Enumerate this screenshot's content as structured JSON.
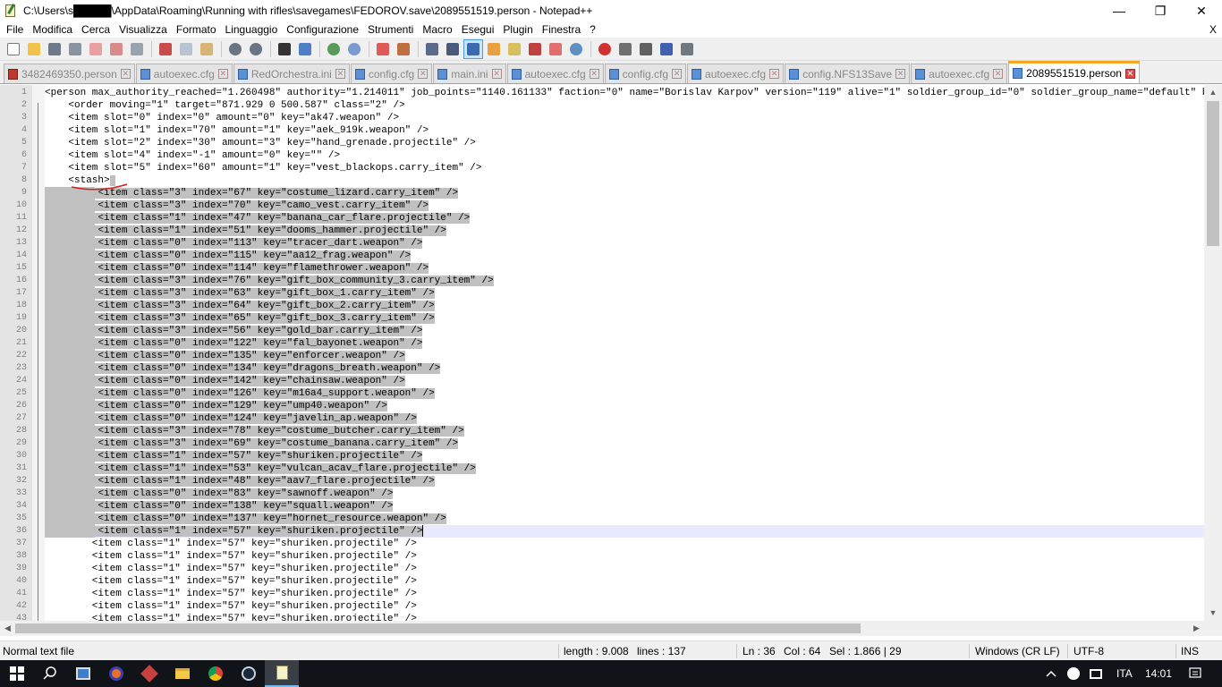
{
  "window": {
    "title": "C:\\Users\\s█████\\AppData\\Roaming\\Running with rifles\\savegames\\FEDOROV.save\\2089551519.person - Notepad++",
    "minimize": "—",
    "maximize": "❐",
    "close": "✕"
  },
  "menu": {
    "items": [
      "File",
      "Modifica",
      "Cerca",
      "Visualizza",
      "Formato",
      "Linguaggio",
      "Configurazione",
      "Strumenti",
      "Macro",
      "Esegui",
      "Plugin",
      "Finestra",
      "?"
    ],
    "close": "X"
  },
  "tabs": [
    {
      "label": "3482469350.person",
      "icon": "file-red"
    },
    {
      "label": "autoexec.cfg",
      "icon": "file-blue"
    },
    {
      "label": "RedOrchestra.ini",
      "icon": "file-blue"
    },
    {
      "label": "config.cfg",
      "icon": "file-blue"
    },
    {
      "label": "main.ini",
      "icon": "file-blue"
    },
    {
      "label": "autoexec.cfg",
      "icon": "file-blue"
    },
    {
      "label": "config.cfg",
      "icon": "file-blue"
    },
    {
      "label": "autoexec.cfg",
      "icon": "file-blue"
    },
    {
      "label": "config.NFS13Save",
      "icon": "file-blue"
    },
    {
      "label": "autoexec.cfg",
      "icon": "file-blue"
    },
    {
      "label": "2089551519.person",
      "icon": "file-blue",
      "active": true
    }
  ],
  "editor": {
    "lines": [
      {
        "n": "1",
        "text": "<person max_authority_reached=\"1.260498\" authority=\"1.214011\" job_points=\"1140.161133\" faction=\"0\" name=\"Borislav Karpov\" version=\"119\" alive=\"1\" soldier_group_id=\"0\" soldier_group_name=\"default\" block=\"",
        "sel": "none"
      },
      {
        "n": "2",
        "text": "    <order moving=\"1\" target=\"871.929 0 500.587\" class=\"2\" />",
        "sel": "none"
      },
      {
        "n": "3",
        "text": "    <item slot=\"0\" index=\"0\" amount=\"0\" key=\"ak47.weapon\" />",
        "sel": "none"
      },
      {
        "n": "4",
        "text": "    <item slot=\"1\" index=\"70\" amount=\"1\" key=\"aek_919k.weapon\" />",
        "sel": "none"
      },
      {
        "n": "5",
        "text": "    <item slot=\"2\" index=\"30\" amount=\"3\" key=\"hand_grenade.projectile\" />",
        "sel": "none"
      },
      {
        "n": "6",
        "text": "    <item slot=\"4\" index=\"-1\" amount=\"0\" key=\"\" />",
        "sel": "none"
      },
      {
        "n": "7",
        "text": "    <item slot=\"5\" index=\"60\" amount=\"1\" key=\"vest_blackops.carry_item\" />",
        "sel": "none"
      },
      {
        "n": "8",
        "text": "    <stash>",
        "sel": "tail"
      },
      {
        "n": "9",
        "text": "        <item class=\"3\" index=\"67\" key=\"costume_lizard.carry_item\" />",
        "sel": "full"
      },
      {
        "n": "10",
        "text": "        <item class=\"3\" index=\"70\" key=\"camo_vest.carry_item\" />",
        "sel": "full"
      },
      {
        "n": "11",
        "text": "        <item class=\"1\" index=\"47\" key=\"banana_car_flare.projectile\" />",
        "sel": "full"
      },
      {
        "n": "12",
        "text": "        <item class=\"1\" index=\"51\" key=\"dooms_hammer.projectile\" />",
        "sel": "full"
      },
      {
        "n": "13",
        "text": "        <item class=\"0\" index=\"113\" key=\"tracer_dart.weapon\" />",
        "sel": "full"
      },
      {
        "n": "14",
        "text": "        <item class=\"0\" index=\"115\" key=\"aa12_frag.weapon\" />",
        "sel": "full"
      },
      {
        "n": "15",
        "text": "        <item class=\"0\" index=\"114\" key=\"flamethrower.weapon\" />",
        "sel": "full"
      },
      {
        "n": "16",
        "text": "        <item class=\"3\" index=\"76\" key=\"gift_box_community_3.carry_item\" />",
        "sel": "full"
      },
      {
        "n": "17",
        "text": "        <item class=\"3\" index=\"63\" key=\"gift_box_1.carry_item\" />",
        "sel": "full"
      },
      {
        "n": "18",
        "text": "        <item class=\"3\" index=\"64\" key=\"gift_box_2.carry_item\" />",
        "sel": "full"
      },
      {
        "n": "19",
        "text": "        <item class=\"3\" index=\"65\" key=\"gift_box_3.carry_item\" />",
        "sel": "full"
      },
      {
        "n": "20",
        "text": "        <item class=\"3\" index=\"56\" key=\"gold_bar.carry_item\" />",
        "sel": "full"
      },
      {
        "n": "21",
        "text": "        <item class=\"0\" index=\"122\" key=\"fal_bayonet.weapon\" />",
        "sel": "full"
      },
      {
        "n": "22",
        "text": "        <item class=\"0\" index=\"135\" key=\"enforcer.weapon\" />",
        "sel": "full"
      },
      {
        "n": "23",
        "text": "        <item class=\"0\" index=\"134\" key=\"dragons_breath.weapon\" />",
        "sel": "full"
      },
      {
        "n": "24",
        "text": "        <item class=\"0\" index=\"142\" key=\"chainsaw.weapon\" />",
        "sel": "full"
      },
      {
        "n": "25",
        "text": "        <item class=\"0\" index=\"126\" key=\"m16a4_support.weapon\" />",
        "sel": "full"
      },
      {
        "n": "26",
        "text": "        <item class=\"0\" index=\"129\" key=\"ump40.weapon\" />",
        "sel": "full"
      },
      {
        "n": "27",
        "text": "        <item class=\"0\" index=\"124\" key=\"javelin_ap.weapon\" />",
        "sel": "full"
      },
      {
        "n": "28",
        "text": "        <item class=\"3\" index=\"78\" key=\"costume_butcher.carry_item\" />",
        "sel": "full"
      },
      {
        "n": "29",
        "text": "        <item class=\"3\" index=\"69\" key=\"costume_banana.carry_item\" />",
        "sel": "full"
      },
      {
        "n": "30",
        "text": "        <item class=\"1\" index=\"57\" key=\"shuriken.projectile\" />",
        "sel": "full"
      },
      {
        "n": "31",
        "text": "        <item class=\"1\" index=\"53\" key=\"vulcan_acav_flare.projectile\" />",
        "sel": "full"
      },
      {
        "n": "32",
        "text": "        <item class=\"1\" index=\"48\" key=\"aav7_flare.projectile\" />",
        "sel": "full"
      },
      {
        "n": "33",
        "text": "        <item class=\"0\" index=\"83\" key=\"sawnoff.weapon\" />",
        "sel": "full"
      },
      {
        "n": "34",
        "text": "        <item class=\"0\" index=\"138\" key=\"squall.weapon\" />",
        "sel": "full"
      },
      {
        "n": "35",
        "text": "        <item class=\"0\" index=\"137\" key=\"hornet_resource.weapon\" />",
        "sel": "full"
      },
      {
        "n": "36",
        "text": "        <item class=\"1\" index=\"57\" key=\"shuriken.projectile\" />",
        "sel": "full",
        "current": true
      },
      {
        "n": "37",
        "text": "        <item class=\"1\" index=\"57\" key=\"shuriken.projectile\" />",
        "sel": "none"
      },
      {
        "n": "38",
        "text": "        <item class=\"1\" index=\"57\" key=\"shuriken.projectile\" />",
        "sel": "none"
      },
      {
        "n": "39",
        "text": "        <item class=\"1\" index=\"57\" key=\"shuriken.projectile\" />",
        "sel": "none"
      },
      {
        "n": "40",
        "text": "        <item class=\"1\" index=\"57\" key=\"shuriken.projectile\" />",
        "sel": "none"
      },
      {
        "n": "41",
        "text": "        <item class=\"1\" index=\"57\" key=\"shuriken.projectile\" />",
        "sel": "none"
      },
      {
        "n": "42",
        "text": "        <item class=\"1\" index=\"57\" key=\"shuriken.projectile\" />",
        "sel": "none"
      },
      {
        "n": "43",
        "text": "        <item class=\"1\" index=\"57\" key=\"shuriken.projectile\" />",
        "sel": "none"
      }
    ]
  },
  "status": {
    "filetype": "Normal text file",
    "length": "length : 9.008",
    "lines": "lines : 137",
    "ln": "Ln : 36",
    "col": "Col : 64",
    "sel": "Sel : 1.866 | 29",
    "eol": "Windows (CR LF)",
    "encoding": "UTF-8",
    "mode": "INS"
  },
  "taskbar": {
    "lang": "ITA",
    "time": "14:01"
  },
  "colors": {
    "selection": "#c0c0c0",
    "current_line": "#e8e8ff",
    "active_tab_accent": "#f5a623",
    "taskbar": "#101418"
  }
}
